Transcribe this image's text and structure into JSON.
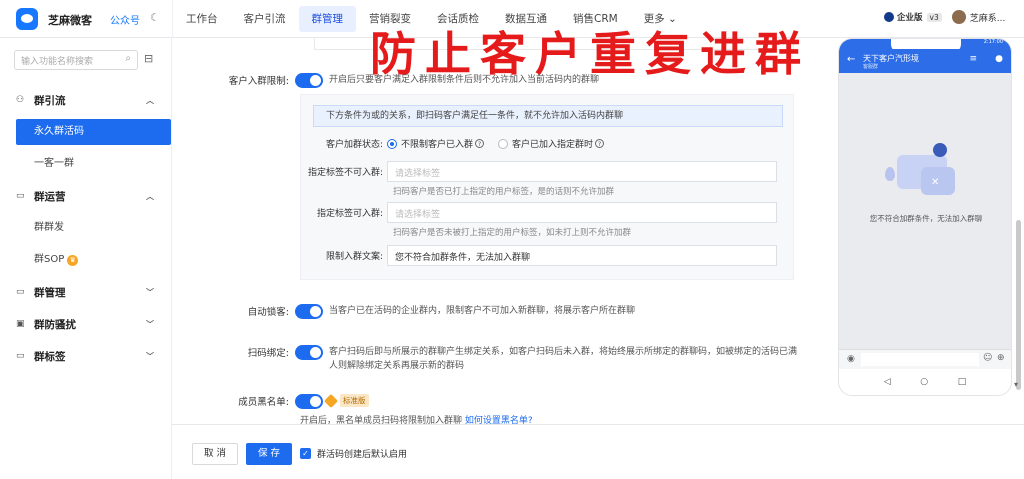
{
  "app": {
    "brand": "芝麻微客",
    "account": "公众号",
    "theme_icon": "moon-icon"
  },
  "topnav": {
    "tabs": [
      "工作台",
      "客户引流",
      "群管理",
      "营销裂变",
      "会话质检",
      "数据互通",
      "销售CRM",
      "更多 ⌄"
    ],
    "active": "群管理"
  },
  "topright": {
    "edition": "企业版",
    "version": "v3",
    "user": "芝麻系..."
  },
  "sidebar": {
    "search_placeholder": "输入功能名称搜索",
    "groups": [
      {
        "label": "群引流",
        "items": [
          "永久群活码",
          "一客一群"
        ]
      },
      {
        "label": "群运营",
        "items": [
          "群群发",
          "群SOP"
        ]
      },
      {
        "label": "群管理",
        "items": []
      },
      {
        "label": "群防骚扰",
        "items": []
      },
      {
        "label": "群标签",
        "items": []
      }
    ],
    "active_item": "永久群活码"
  },
  "overlay_text": "防止客户重复进群",
  "form": {
    "join_limit": {
      "label": "客户入群限制:",
      "desc": "开启后只要客户满足入群限制条件后则不允许加入当前活码内的群聊"
    },
    "panel": {
      "tip": "下方条件为或的关系，即扫码客户满足任一条件，就不允许加入活码内群聊",
      "status_label": "客户加群状态:",
      "status_options": [
        "不限制客户已入群",
        "客户已加入指定群时"
      ],
      "tag_block_label": "指定标签不可入群:",
      "tag_block_placeholder": "请选择标签",
      "tag_block_hint": "扫码客户是否已打上指定的用户标签，是的话则不允许加群",
      "tag_allow_label": "指定标签可入群:",
      "tag_allow_placeholder": "请选择标签",
      "tag_allow_hint": "扫码客户是否未被打上指定的用户标签，如未打上则不允许加群",
      "copy_label": "限制入群文案:",
      "copy_value": "您不符合加群条件，无法加入群聊"
    },
    "auto_dedupe": {
      "label": "自动锁客:",
      "desc": "当客户已在活码的企业群内，限制客户不可加入新群聊，将展示客户所在群聊"
    },
    "scan_bind": {
      "label": "扫码绑定:",
      "desc_1": "客户扫码后即与所展示的群聊产生绑定关系，如客户扫码后未入群，将始终展示所绑定的群聊码，如被绑定的活码已满",
      "desc_2": "人则解除绑定关系再展示新的群码"
    },
    "blacklist": {
      "label": "成员黑名单:",
      "badge": "标准版",
      "desc": "开启后，黑名单成员扫码将限制加入群聊",
      "link": "如何设置黑名单?"
    }
  },
  "footer": {
    "cancel": "取 消",
    "save": "保 存",
    "checkbox_label": "群活码创建后默认启用"
  },
  "phone": {
    "status": "2:17:00",
    "title": "天下客户汽形境",
    "subtitle": "客服群",
    "message": "您不符合加群条件，无法加入群聊"
  },
  "colors": {
    "accent": "#1d6cf0",
    "overlay": "#e51b1b"
  }
}
